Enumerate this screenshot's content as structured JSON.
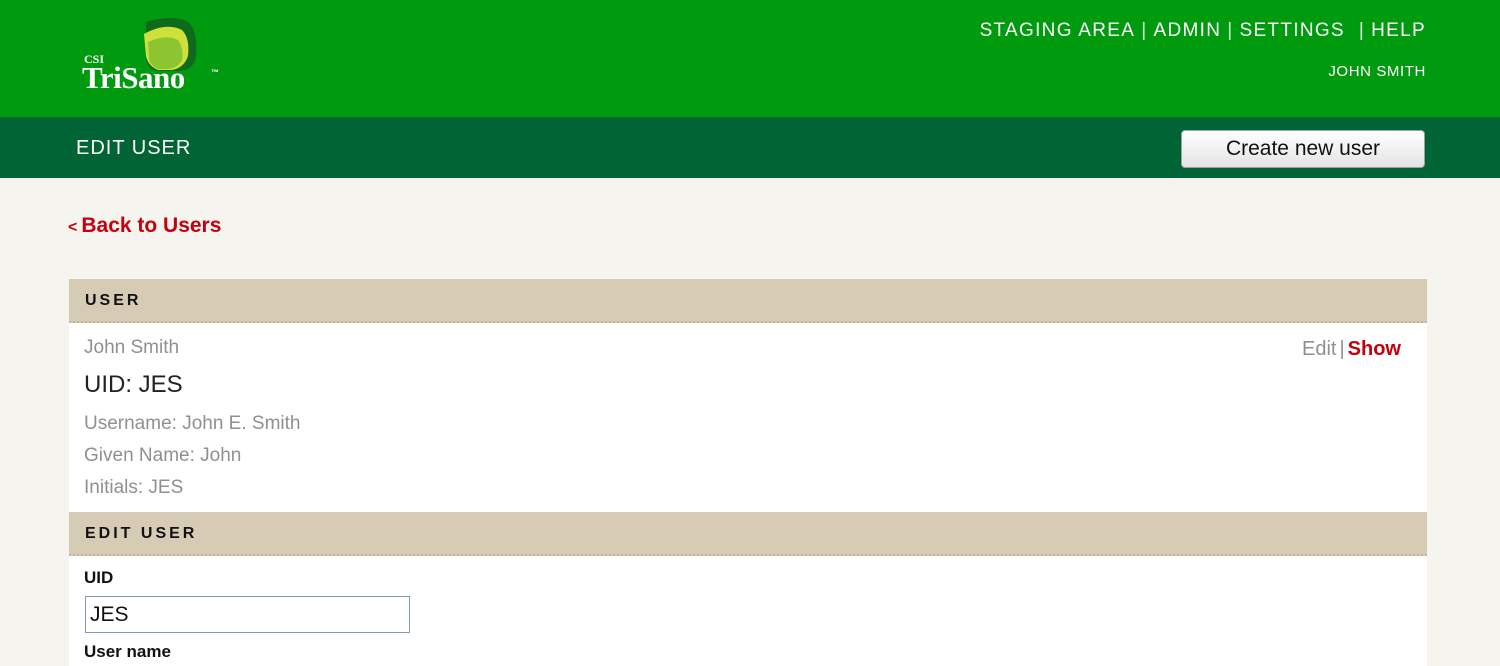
{
  "logo": {
    "prefix": "CSI",
    "name": "TriSano",
    "trademark": "™",
    "icon": "leaf-logo-icon"
  },
  "top_nav": {
    "items": [
      "STAGING AREA",
      "ADMIN",
      "SETTINGS",
      "HELP"
    ],
    "separator": "|",
    "current_user": "JOHN SMITH"
  },
  "subheader": {
    "title": "EDIT USER",
    "create_button_label": "Create new user"
  },
  "back_link": {
    "arrow": "<",
    "label": "Back to Users"
  },
  "user_section": {
    "heading": "USER",
    "full_name": "John Smith",
    "uid_line": "UID: JES",
    "username_line": "Username: John E. Smith",
    "given_name_line": "Given Name: John",
    "initials_line": "Initials: JES",
    "toggle": {
      "edit_label": "Edit",
      "separator": "|",
      "show_label": "Show"
    }
  },
  "edit_section": {
    "heading": "EDIT USER",
    "uid_label": "UID",
    "uid_value": "JES",
    "username_label": "User name"
  },
  "colors": {
    "top_bar": "#009a0f",
    "sub_bar": "#006434",
    "section_header": "#d6ccb6",
    "link_red": "#c4010f",
    "page_bg": "#f6f4ef"
  }
}
